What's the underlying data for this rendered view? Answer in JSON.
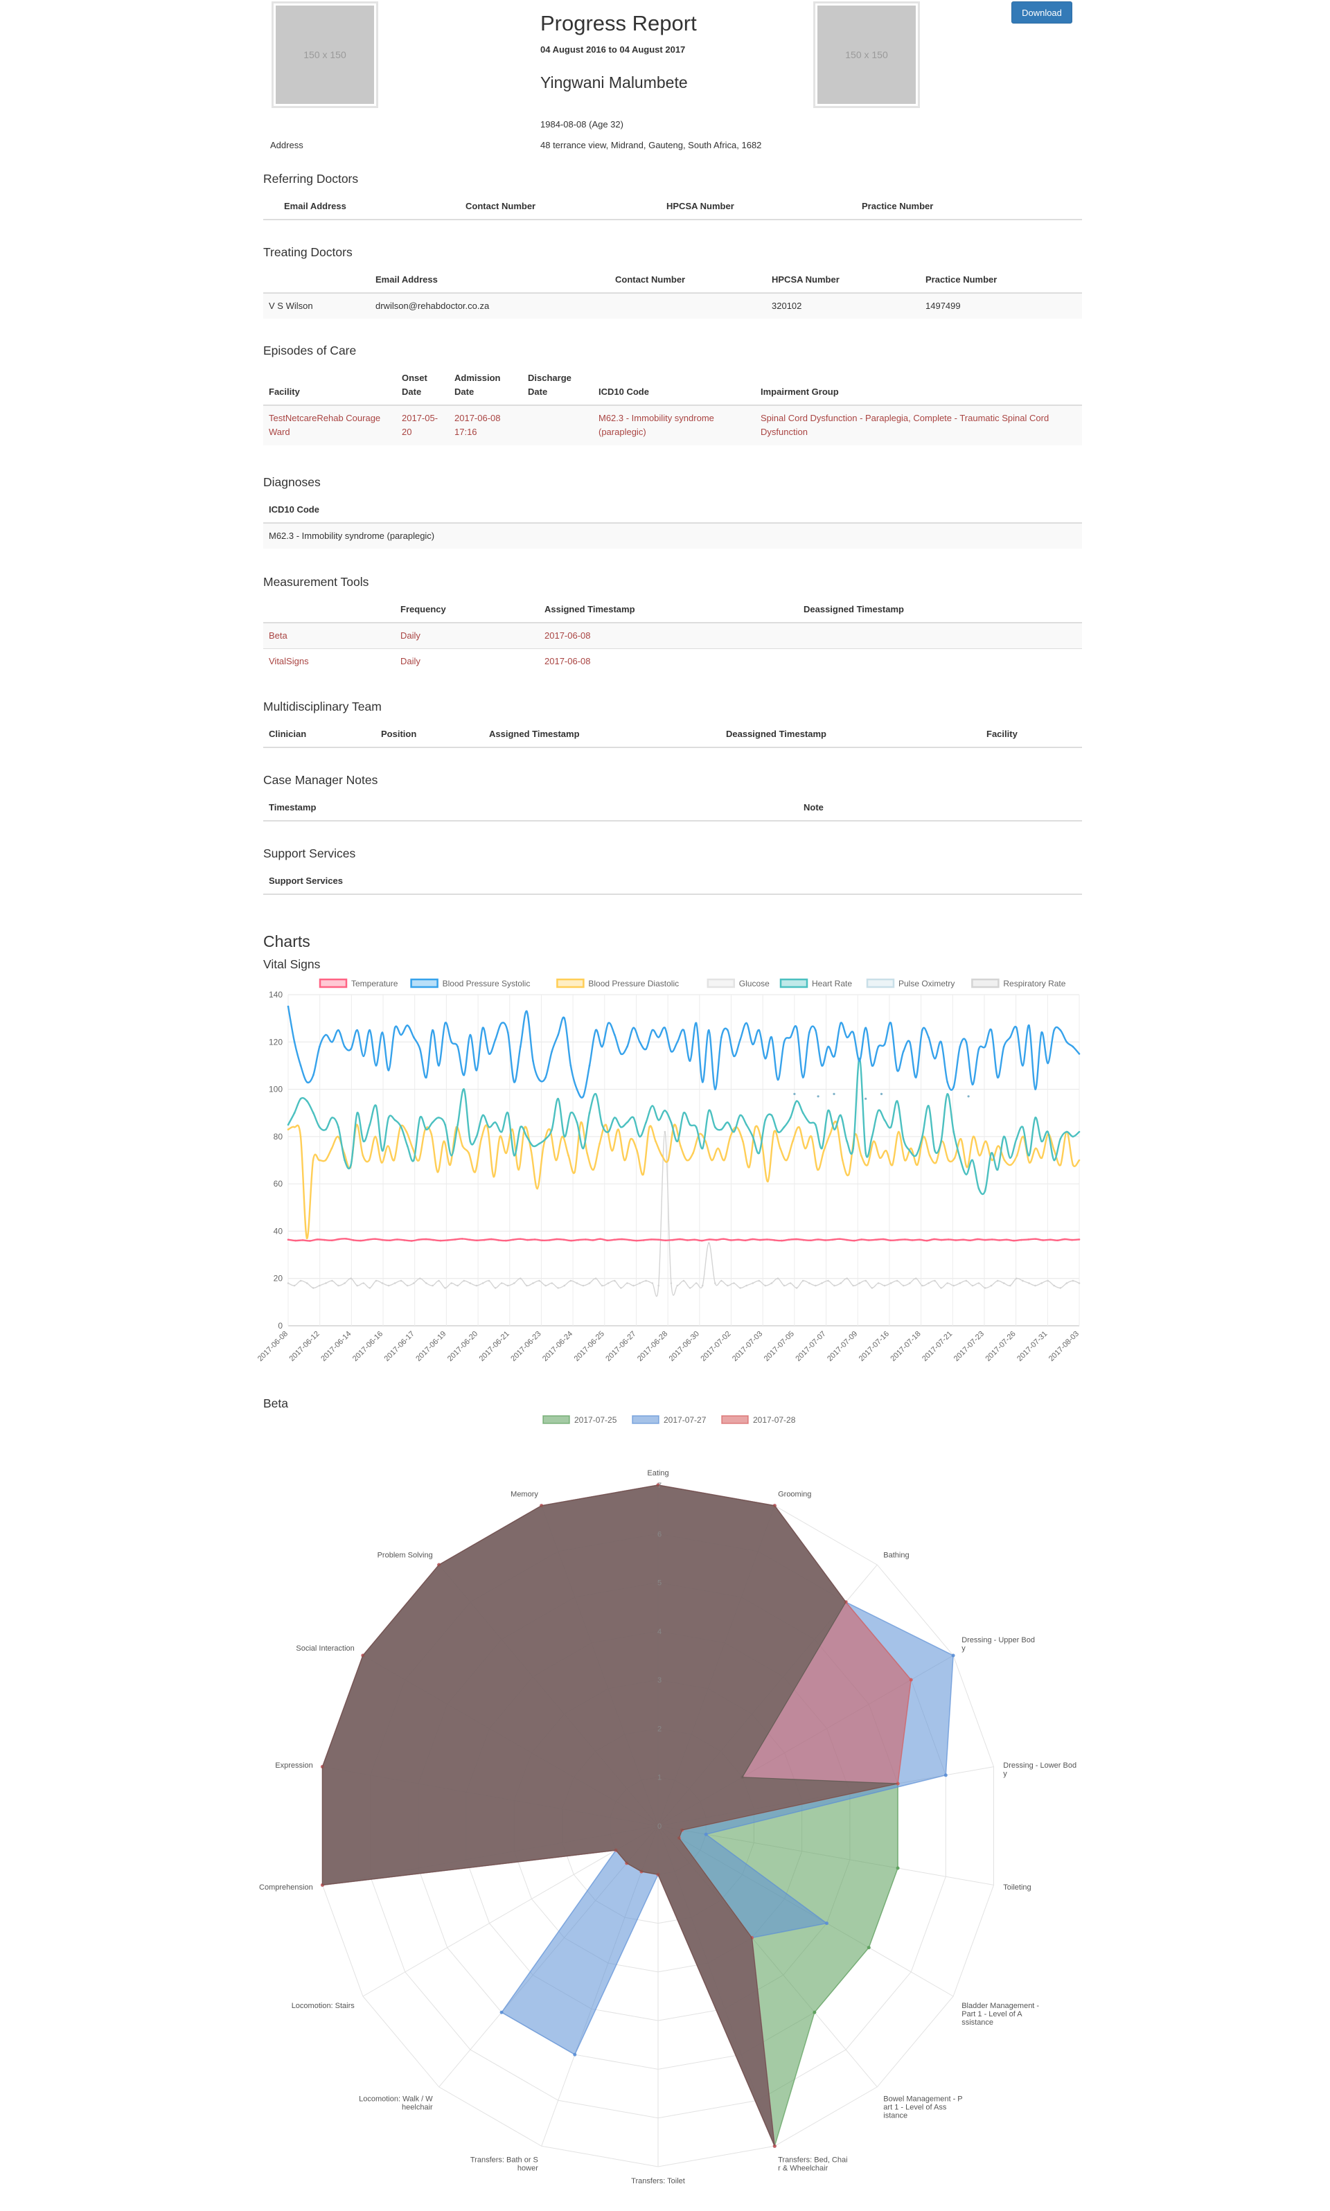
{
  "header": {
    "placeholder_left": "150 x 150",
    "placeholder_right": "150 x 150",
    "title": "Progress Report",
    "date_range": "04 August 2016 to 04 August 2017",
    "patient_name": "Yingwani Malumbete",
    "dob": "1984-08-08 (Age 32)",
    "address_label": "Address",
    "address_value": "48 terrance view, Midrand, Gauteng, South Africa, 1682",
    "download_label": "Download"
  },
  "referring_doctors": {
    "title": "Referring Doctors",
    "columns": [
      "Email Address",
      "Contact Number",
      "HPCSA Number",
      "Practice Number"
    ]
  },
  "treating_doctors": {
    "title": "Treating Doctors",
    "columns": [
      "",
      "Email Address",
      "Contact Number",
      "HPCSA Number",
      "Practice Number"
    ],
    "rows": [
      [
        "V S Wilson",
        "drwilson@rehabdoctor.co.za",
        "",
        "320102",
        "1497499"
      ]
    ]
  },
  "episodes": {
    "title": "Episodes of Care",
    "columns": [
      "Facility",
      "Onset Date",
      "Admission Date",
      "Discharge Date",
      "ICD10 Code",
      "Impairment Group"
    ],
    "rows": [
      [
        "TestNetcareRehab Courage Ward",
        "2017-05-20",
        "2017-06-08 17:16",
        "",
        "M62.3 - Immobility syndrome (paraplegic)",
        "Spinal Cord Dysfunction - Paraplegia, Complete - Traumatic Spinal Cord Dysfunction"
      ]
    ]
  },
  "diagnoses": {
    "title": "Diagnoses",
    "columns": [
      "ICD10 Code"
    ],
    "rows": [
      [
        "M62.3 - Immobility syndrome (paraplegic)"
      ]
    ]
  },
  "measurement_tools": {
    "title": "Measurement Tools",
    "columns": [
      "",
      "Frequency",
      "Assigned Timestamp",
      "Deassigned Timestamp"
    ],
    "rows": [
      [
        "Beta",
        "Daily",
        "2017-06-08",
        ""
      ],
      [
        "VitalSigns",
        "Daily",
        "2017-06-08",
        ""
      ]
    ]
  },
  "team": {
    "title": "Multidisciplinary Team",
    "columns": [
      "Clinician",
      "Position",
      "Assigned Timestamp",
      "Deassigned Timestamp",
      "Facility"
    ]
  },
  "notes": {
    "title": "Case Manager Notes",
    "columns": [
      "Timestamp",
      "Note"
    ]
  },
  "support": {
    "title": "Support Services",
    "columns": [
      "Support Services"
    ]
  },
  "charts": {
    "heading": "Charts",
    "vital_title": "Vital Signs",
    "beta_title": "Beta"
  },
  "chart_data": [
    {
      "type": "line",
      "title": "Vital Signs",
      "ylim": [
        0,
        140
      ],
      "yticks": [
        0,
        20,
        40,
        60,
        80,
        100,
        120,
        140
      ],
      "grid": true,
      "legend_position": "top",
      "x_tick_labels": [
        "2017-06-08",
        "2017-06-12",
        "2017-06-14",
        "2017-06-16",
        "2017-06-17",
        "2017-06-19",
        "2017-06-20",
        "2017-06-21",
        "2017-06-23",
        "2017-06-24",
        "2017-06-25",
        "2017-06-27",
        "2017-06-28",
        "2017-06-30",
        "2017-07-02",
        "2017-07-03",
        "2017-07-05",
        "2017-07-07",
        "2017-07-09",
        "2017-07-16",
        "2017-07-18",
        "2017-07-21",
        "2017-07-23",
        "2017-07-26",
        "2017-07-31",
        "2017-08-03"
      ],
      "series": [
        {
          "name": "Temperature",
          "color": "#ff6384",
          "values": [
            36.4,
            36.0,
            36.2,
            35.9,
            36.5,
            36.3,
            36.1,
            36.6,
            36.8,
            36.2,
            36.0,
            36.4,
            36.7,
            36.3,
            36.1,
            36.5,
            36.2,
            35.9,
            36.4,
            36.6,
            36.3,
            36.0,
            36.2,
            36.5,
            36.8,
            36.4,
            36.1,
            36.3,
            36.6,
            36.2,
            36.0,
            36.4,
            36.7,
            36.3,
            36.5,
            36.1,
            36.2,
            36.6,
            36.4,
            36.0,
            36.3,
            36.5,
            36.2,
            36.7,
            36.1,
            36.4,
            36.6,
            36.3,
            36.0,
            36.2,
            36.5,
            36.4,
            36.1,
            36.3,
            36.6,
            36.2,
            36.4,
            36.0,
            36.5,
            36.3,
            36.7,
            36.2,
            36.4,
            36.1,
            36.6,
            36.3,
            36.5,
            36.2,
            36.0,
            36.4,
            36.6,
            36.3,
            36.1,
            36.5,
            36.2,
            36.4,
            36.7,
            36.3,
            36.0,
            36.5,
            36.2,
            36.4,
            36.6,
            36.1,
            36.3,
            36.5,
            36.2,
            36.4,
            36.0,
            36.6,
            36.3,
            36.5,
            36.2,
            36.4,
            36.1,
            36.6,
            36.3,
            36.5,
            36.2,
            36.4,
            36.0,
            36.3,
            36.5,
            36.7,
            36.2,
            36.4,
            36.1,
            36.6,
            36.3,
            36.5
          ]
        },
        {
          "name": "Blood Pressure Systolic",
          "color": "#36a2eb",
          "values": [
            135,
            120,
            110,
            103,
            106,
            118,
            123,
            120,
            125,
            118,
            117,
            125,
            114,
            125,
            110,
            124,
            108,
            126,
            123,
            127,
            122,
            117,
            105,
            125,
            110,
            128,
            120,
            118,
            106,
            123,
            108,
            126,
            115,
            121,
            128,
            124,
            103,
            118,
            133,
            112,
            104,
            105,
            116,
            123,
            130,
            110,
            100,
            97,
            110,
            125,
            118,
            128,
            123,
            115,
            118,
            126,
            120,
            117,
            125,
            122,
            126,
            116,
            120,
            125,
            112,
            128,
            103,
            125,
            100,
            122,
            125,
            114,
            121,
            128,
            119,
            125,
            113,
            122,
            104,
            120,
            122,
            126,
            105,
            124,
            125,
            110,
            118,
            114,
            128,
            122,
            124,
            112,
            126,
            110,
            118,
            119,
            128,
            108,
            116,
            120,
            105,
            125,
            122,
            113,
            120,
            103,
            101,
            118,
            120,
            102,
            117,
            118,
            125,
            105,
            118,
            122,
            126,
            110,
            127,
            100,
            124,
            111,
            125,
            125,
            120,
            118,
            115
          ]
        },
        {
          "name": "Blood Pressure Diastolic",
          "color": "#ffce56",
          "values": [
            83,
            84,
            80,
            37,
            70,
            70,
            70,
            75,
            80,
            73,
            67,
            85,
            72,
            70,
            80,
            69,
            76,
            70,
            84,
            82,
            75,
            70,
            83,
            81,
            65,
            78,
            68,
            84,
            76,
            73,
            65,
            79,
            84,
            63,
            80,
            73,
            83,
            66,
            84,
            74,
            58,
            76,
            83,
            70,
            80,
            72,
            65,
            86,
            73,
            66,
            77,
            85,
            74,
            83,
            70,
            79,
            74,
            64,
            84,
            78,
            72,
            70,
            85,
            76,
            70,
            73,
            81,
            78,
            70,
            75,
            70,
            80,
            84,
            78,
            67,
            84,
            78,
            61,
            82,
            75,
            70,
            78,
            84,
            75,
            80,
            66,
            74,
            81,
            86,
            70,
            64,
            81,
            72,
            68,
            78,
            71,
            74,
            68,
            82,
            70,
            75,
            68,
            80,
            72,
            69,
            78,
            70,
            71,
            79,
            67,
            80,
            72,
            78,
            70,
            76,
            70,
            68,
            72,
            80,
            69,
            75,
            71,
            81,
            74,
            68,
            82,
            68,
            70
          ]
        },
        {
          "name": "Glucose",
          "color": "#e3e3e3",
          "values": []
        },
        {
          "name": "Heart Rate",
          "color": "#4bc0c0",
          "values": [
            85,
            90,
            96,
            95,
            90,
            84,
            83,
            88,
            84,
            70,
            68,
            90,
            78,
            85,
            93,
            74,
            88,
            87,
            84,
            76,
            70,
            88,
            83,
            86,
            88,
            85,
            72,
            85,
            100,
            78,
            80,
            89,
            84,
            86,
            82,
            90,
            72,
            84,
            80,
            76,
            77,
            79,
            83,
            96,
            80,
            90,
            86,
            75,
            90,
            98,
            85,
            82,
            88,
            84,
            86,
            88,
            80,
            86,
            93,
            87,
            91,
            86,
            78,
            90,
            85,
            84,
            75,
            91,
            84,
            83,
            86,
            82,
            89,
            85,
            80,
            73,
            87,
            89,
            82,
            84,
            88,
            95,
            90,
            86,
            85,
            75,
            91,
            83,
            89,
            78,
            75,
            113,
            73,
            80,
            91,
            87,
            84,
            95,
            79,
            74,
            72,
            80,
            93,
            74,
            78,
            98,
            82,
            71,
            64,
            70,
            58,
            57,
            73,
            66,
            80,
            71,
            79,
            84,
            72,
            88,
            78,
            82,
            70,
            79,
            82,
            80,
            82
          ]
        },
        {
          "name": "Pulse Oximetry",
          "color": "#c9dfe8",
          "values": [
            98,
            97,
            98,
            96,
            98,
            97
          ]
        },
        {
          "name": "Respiratory Rate",
          "color": "#d4d4d4",
          "values": [
            18,
            17,
            19,
            18,
            16,
            17,
            18,
            19,
            17,
            18,
            20,
            17,
            18,
            16,
            19,
            18,
            17,
            18,
            19,
            17,
            18,
            20,
            18,
            17,
            19,
            16,
            18,
            17,
            19,
            18,
            17,
            18,
            19,
            16,
            18,
            17,
            18,
            20,
            17,
            18,
            19,
            17,
            18,
            16,
            17,
            19,
            18,
            17,
            18,
            20,
            17,
            18,
            19,
            16,
            18,
            17,
            18,
            19,
            18,
            17,
            82,
            18,
            17,
            19,
            16,
            18,
            17,
            35,
            18,
            19,
            17,
            18,
            16,
            17,
            18,
            19,
            17,
            18,
            20,
            17,
            18,
            16,
            19,
            18,
            17,
            18,
            19,
            17,
            18,
            20,
            17,
            18,
            19,
            16,
            18,
            17,
            18,
            19,
            17,
            18,
            20,
            17,
            18,
            19,
            16,
            18,
            17,
            18,
            19,
            17,
            18,
            16,
            17,
            19,
            18,
            17,
            20,
            19,
            18,
            17,
            18,
            19,
            17,
            16,
            18,
            19,
            18
          ]
        }
      ]
    },
    {
      "type": "radar",
      "title": "Beta",
      "r_range": [
        0,
        7
      ],
      "legend_position": "top",
      "axes": [
        "Eating",
        "Grooming",
        "Bathing",
        "Dressing - Upper Body",
        "Dressing - Lower Body",
        "Toileting",
        "Bladder Management - Part 1 - Level of Assistance",
        "Bowel Management - Part 1 - Level of Assistance",
        "Transfers: Bed, Chair & Wheelchair",
        "Transfers: Toilet",
        "Transfers: Bath or Shower",
        "Locomotion: Walk / Wheelchair",
        "Locomotion: Stairs",
        "Comprehension",
        "Expression",
        "Social Interaction",
        "Problem Solving",
        "Memory"
      ],
      "axis_label_lines": [
        [
          "Eating"
        ],
        [
          "Grooming"
        ],
        [
          "Bathing"
        ],
        [
          "Dressing - Upper Bod",
          "y"
        ],
        [
          "Dressing - Lower Bod",
          "y"
        ],
        [
          "Toileting"
        ],
        [
          "Bladder Management -",
          "Part 1 - Level of A",
          "ssistance"
        ],
        [
          "Bowel Management - P",
          "art 1 - Level of Ass",
          "istance"
        ],
        [
          "Transfers: Bed, Chai",
          "r & Wheelchair"
        ],
        [
          "Transfers: Toilet"
        ],
        [
          "Transfers: Bath or S",
          "hower"
        ],
        [
          "Locomotion: Walk / W",
          "heelchair"
        ],
        [
          "Locomotion: Stairs"
        ],
        [
          "Comprehension"
        ],
        [
          "Expression"
        ],
        [
          "Social Interaction"
        ],
        [
          "Problem Solving"
        ],
        [
          "Memory"
        ]
      ],
      "series": [
        {
          "name": "2017-07-25",
          "color": "#5a9e5a",
          "values": [
            7,
            7,
            6,
            2,
            5,
            5,
            5,
            5,
            7,
            1,
            1,
            1,
            1,
            7,
            7,
            7,
            7,
            7
          ]
        },
        {
          "name": "2017-07-27",
          "color": "#5b8fd6",
          "values": [
            7,
            7,
            6,
            7,
            6,
            1,
            4,
            3,
            7,
            1,
            5,
            5,
            1,
            7,
            7,
            7,
            7,
            7
          ]
        },
        {
          "name": "2017-07-28",
          "color": "#d65b5b",
          "values": [
            7,
            7,
            6,
            6,
            5,
            0.5,
            0.5,
            3,
            7,
            1,
            1,
            1,
            1,
            7,
            7,
            7,
            7,
            7
          ]
        }
      ]
    }
  ]
}
